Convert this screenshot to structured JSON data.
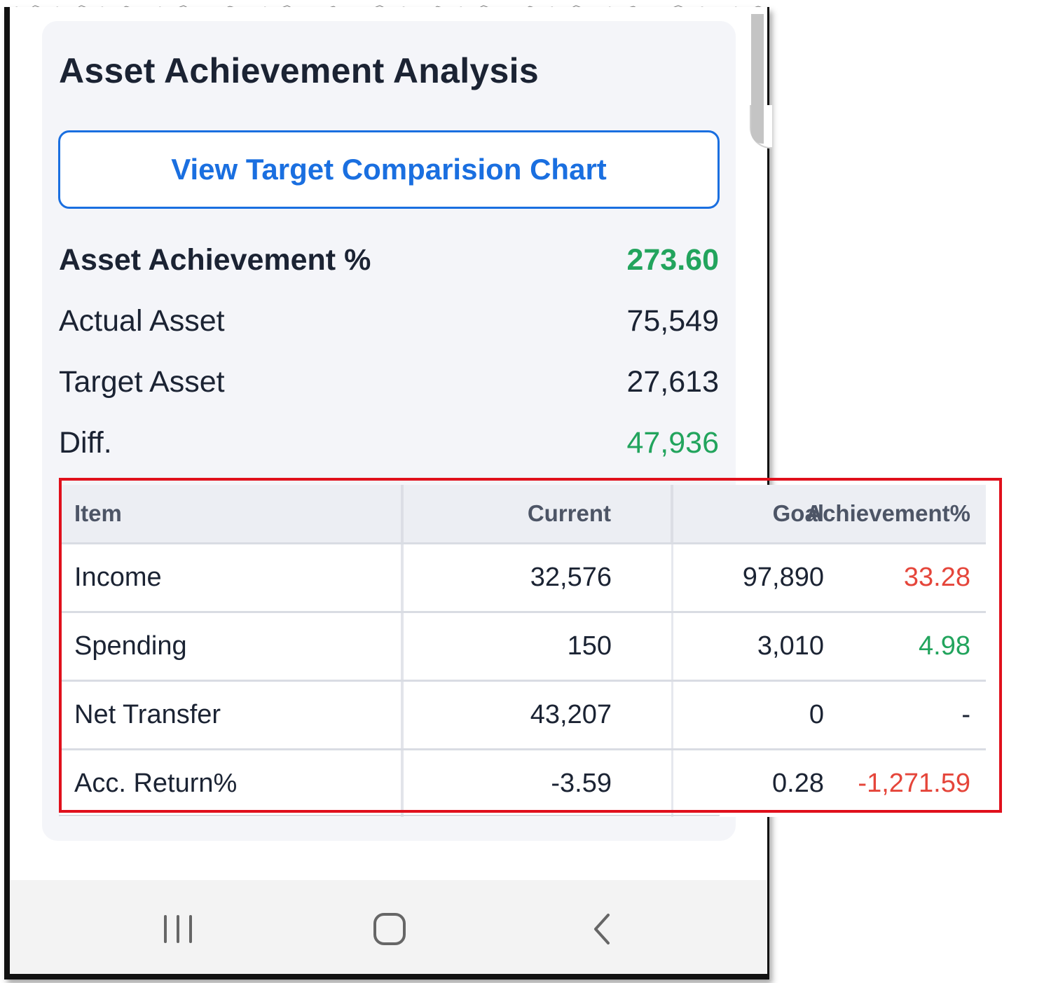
{
  "card": {
    "title": "Asset Achievement Analysis",
    "view_chart_button": "View Target Comparision Chart"
  },
  "summary": [
    {
      "label": "Asset Achievement %",
      "value": "273.60",
      "color": "#22a45d",
      "bold": true
    },
    {
      "label": "Actual Asset",
      "value": "75,549"
    },
    {
      "label": "Target Asset",
      "value": "27,613"
    },
    {
      "label": "Diff.",
      "value": "47,936",
      "color": "#22a45d"
    }
  ],
  "table": {
    "headers": [
      "Item",
      "Current",
      "Goal",
      "Achievement%"
    ],
    "rows": [
      {
        "item": "Income",
        "current": "32,576",
        "goal": "97,890",
        "achievement": "33.28",
        "achievement_color": "#e5453a"
      },
      {
        "item": "Spending",
        "current": "150",
        "goal": "3,010",
        "achievement": "4.98",
        "achievement_color": "#22a45d"
      },
      {
        "item": "Net Transfer",
        "current": "43,207",
        "goal": "0",
        "achievement": "-"
      },
      {
        "item": "Acc. Return%",
        "current": "-3.59",
        "goal": "0.28",
        "achievement": "-1,271.59",
        "achievement_color": "#e5453a"
      }
    ]
  },
  "navbar": {
    "icons": [
      "recent-apps-icon",
      "home-icon",
      "back-icon"
    ]
  },
  "colors": {
    "accent": "#1a6fe0",
    "positive": "#22a45d",
    "negative": "#e5453a",
    "highlight": "#e0101c"
  }
}
